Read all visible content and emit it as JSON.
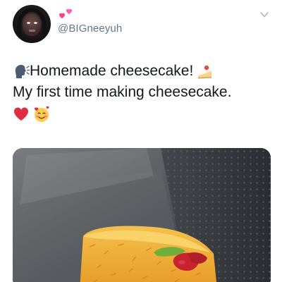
{
  "user": {
    "handle": "@BIGneeyuh",
    "avatar_icon": "profile-photo",
    "name_icon": "two-hearts-emoji"
  },
  "menu": {
    "icon": "chevron-down-icon"
  },
  "tweet": {
    "line1_icon": "speaking-head-emoji",
    "line1_text": "Homemade cheesecake!",
    "line1_trailing_icon": "shortcake-emoji",
    "line2_text": "My first time making cheesecake.",
    "emojis": [
      "red-heart-emoji",
      "smiling-face-with-hearts-emoji"
    ]
  },
  "media": {
    "description_icon": "cheesecake-photo"
  },
  "colors": {
    "text": "#14171a",
    "handle": "#657786",
    "heart": "#e0245e",
    "cheese": "#f0b43a"
  }
}
